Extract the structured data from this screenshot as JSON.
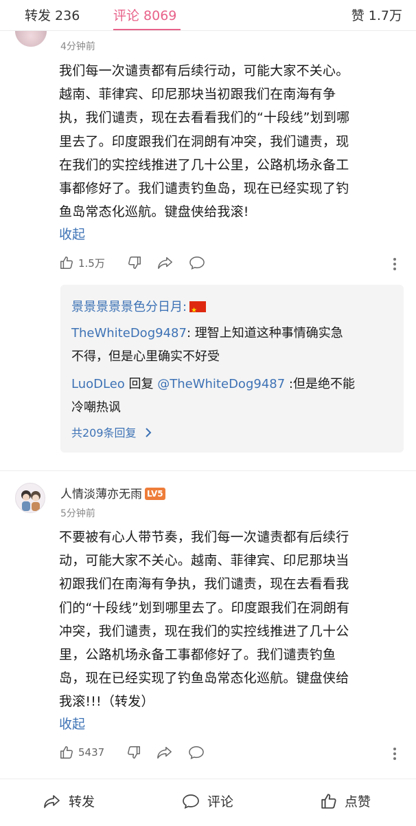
{
  "tabs": {
    "repost": "转发 236",
    "comments": "评论 8069",
    "likes": "赞 1.7万"
  },
  "comment1": {
    "time": "4分钟前",
    "lines": [
      "我们每一次谴责都有后续行动，可能大家不关心。",
      "越南、菲律宾、印尼那块当初跟我们在南海有争",
      "执，我们谴责，现在去看看我们的“十段线”划到哪",
      "里去了。印度跟我们在洞朗有冲突，我们谴责，现",
      "在我们的实控线推进了几十公里，公路机场永备工",
      "事都修好了。我们谴责钓鱼岛，现在已经实现了钓",
      "鱼岛常态化巡航。键盘侠给我滚!"
    ],
    "collapse": "收起",
    "like_count": "1.5万"
  },
  "replies": {
    "r1_name": "景景景景景色分日月:",
    "r2_name": "TheWhiteDog9487",
    "r2_text_a": ": 理智上知道这种事情确实急",
    "r2_text_b": "不得，但是心里确实不好受",
    "r3_name": "LuoDLeo",
    "r3_mid": " 回复 ",
    "r3_at": "@TheWhiteDog9487",
    "r3_text_a": " :但是绝不能",
    "r3_text_b": "冷嘲热讽",
    "view_all": "共209条回复"
  },
  "comment2": {
    "username": "人情淡薄亦无雨",
    "level": "LV5",
    "time": "5分钟前",
    "lines": [
      "不要被有心人带节奏，我们每一次谴责都有后续行",
      "动，可能大家不关心。越南、菲律宾、印尼那块当",
      "初跟我们在南海有争执，我们谴责，现在去看看我",
      "们的“十段线”划到哪里去了。印度跟我们在洞朗有",
      "冲突，我们谴责，现在我们的实控线推进了几十公",
      "里，公路机场永备工事都修好了。我们谴责钓鱼",
      "岛，现在已经实现了钓鱼岛常态化巡航。键盘侠给",
      "我滚!!!（转发）"
    ],
    "collapse": "收起",
    "like_count": "5437"
  },
  "bottom": {
    "repost": "转发",
    "comment": "评论",
    "like": "点赞"
  },
  "colors": {
    "accent": "#e8628a",
    "link": "#3d72b5"
  },
  "icons": [
    "thumb-up-icon",
    "thumb-down-icon",
    "share-icon",
    "comment-icon",
    "more-icon",
    "chevron-right-icon",
    "china-flag-icon"
  ]
}
